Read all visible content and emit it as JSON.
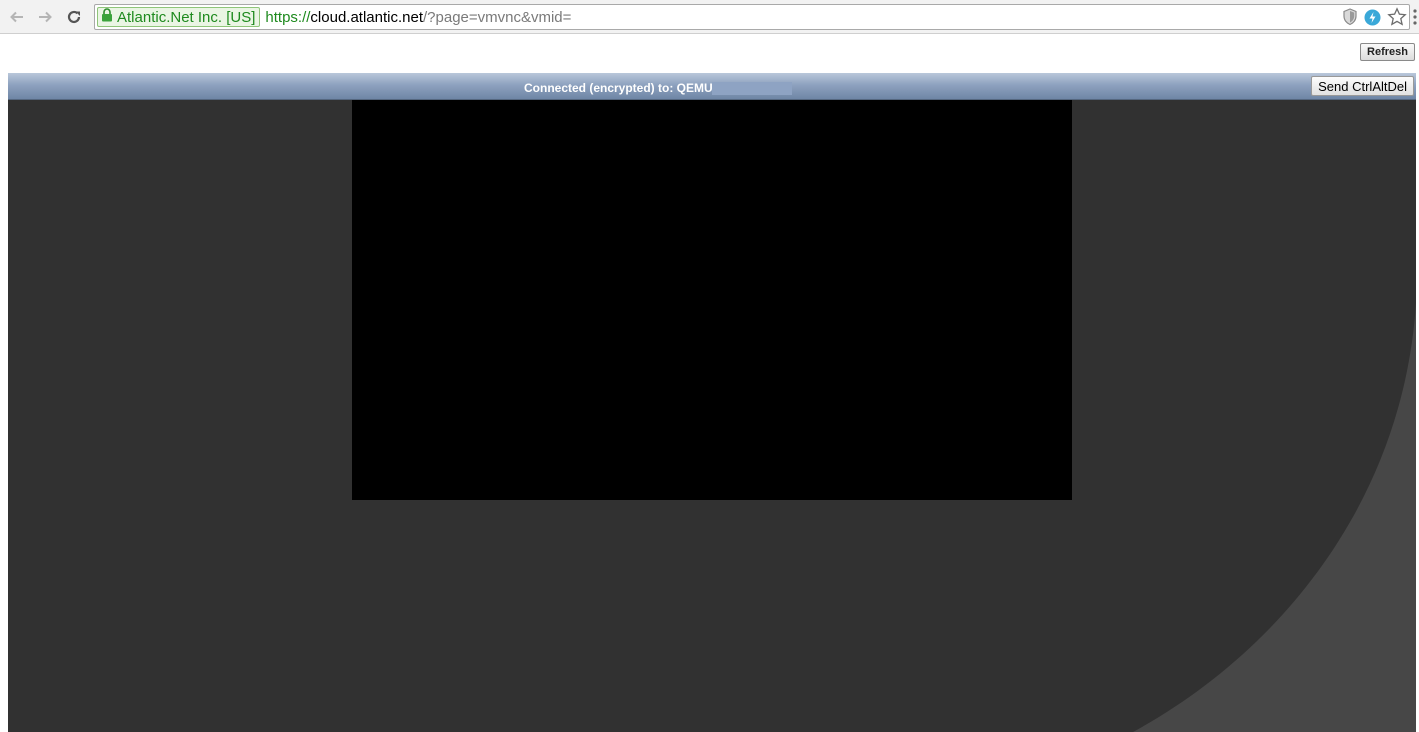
{
  "browser": {
    "ev_label": "Atlantic.Net Inc. [US]",
    "url_scheme": "https://",
    "url_host": "cloud.atlantic.net",
    "url_path": "/?page=vmvnc&vmid=",
    "icons": [
      "back-arrow-icon",
      "forward-arrow-icon",
      "reload-icon",
      "lock-icon",
      "shield-icon",
      "extension-bolt-icon",
      "bookmark-star-icon",
      "menu-icon"
    ]
  },
  "page": {
    "refresh_label": "Refresh"
  },
  "vnc": {
    "status_text": "Connected (encrypted) to: QEMU",
    "ctrlaltdel_label": "Send CtrlAltDel",
    "colors": {
      "panel_bg": "#313131",
      "statusbar_top": "#b9c7da",
      "statusbar_bottom": "#6f86a6",
      "screen_bg": "#000000"
    }
  }
}
